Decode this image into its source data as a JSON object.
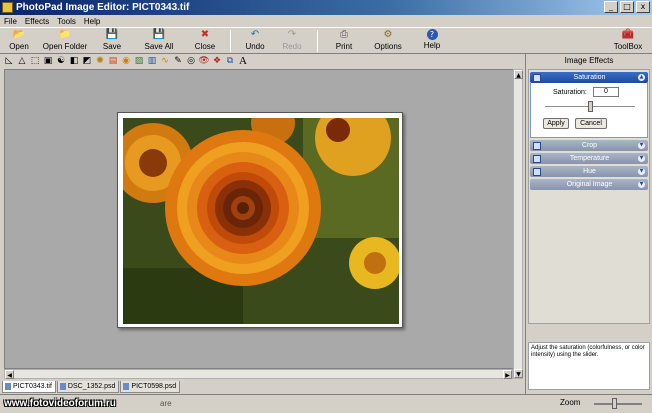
{
  "window": {
    "title": "PhotoPad Image Editor: PICT0343.tif",
    "controls": [
      "_",
      "□",
      "x"
    ]
  },
  "menu": [
    "File",
    "Effects",
    "Tools",
    "Help"
  ],
  "toolbar": [
    {
      "id": "open",
      "label": "Open",
      "icon": "open-icon",
      "glyph": "📂",
      "enabled": true
    },
    {
      "id": "open-folder",
      "label": "Open Folder",
      "icon": "open-folder-icon",
      "glyph": "📁",
      "enabled": true
    },
    {
      "id": "save",
      "label": "Save",
      "icon": "save-icon",
      "glyph": "💾",
      "enabled": true
    },
    {
      "id": "save-all",
      "label": "Save All",
      "icon": "save-all-icon",
      "glyph": "💾",
      "enabled": true
    },
    {
      "id": "close",
      "label": "Close",
      "icon": "close-icon",
      "glyph": "✖",
      "enabled": true
    },
    {
      "id": "undo",
      "label": "Undo",
      "icon": "undo-icon",
      "glyph": "↶",
      "enabled": true
    },
    {
      "id": "redo",
      "label": "Redo",
      "icon": "redo-icon",
      "glyph": "↷",
      "enabled": false
    },
    {
      "id": "print",
      "label": "Print",
      "icon": "print-icon",
      "glyph": "⎙",
      "enabled": true
    },
    {
      "id": "options",
      "label": "Options",
      "icon": "options-icon",
      "glyph": "⚙",
      "enabled": true
    },
    {
      "id": "help",
      "label": "Help",
      "icon": "help-icon",
      "glyph": "?",
      "enabled": true
    },
    {
      "id": "toolbox",
      "label": "ToolBox",
      "icon": "toolbox-icon",
      "glyph": "🧰",
      "enabled": true
    }
  ],
  "tools": [
    {
      "name": "crop-tool-icon",
      "glyph": "◺"
    },
    {
      "name": "triangle-tool-icon",
      "glyph": "△"
    },
    {
      "name": "select-tool-icon",
      "glyph": "⬚"
    },
    {
      "name": "rect-select-tool-icon",
      "glyph": "▣"
    },
    {
      "name": "yin-yang-tool-icon",
      "glyph": "☯"
    },
    {
      "name": "contrast-tool-icon",
      "glyph": "◧"
    },
    {
      "name": "levels-tool-icon",
      "glyph": "◩"
    },
    {
      "name": "brightness-tool-icon",
      "glyph": "✺"
    },
    {
      "name": "gradient-tool-icon",
      "glyph": "▤"
    },
    {
      "name": "color-tool-icon",
      "glyph": "◉"
    },
    {
      "name": "landscape-tool-icon",
      "glyph": "▨"
    },
    {
      "name": "histogram-tool-icon",
      "glyph": "▥"
    },
    {
      "name": "wave-tool-icon",
      "glyph": "∿"
    },
    {
      "name": "brush-tool-icon",
      "glyph": "✎"
    },
    {
      "name": "vignette-tool-icon",
      "glyph": "◎"
    },
    {
      "name": "red-eye-tool-icon",
      "glyph": "👁"
    },
    {
      "name": "spots-tool-icon",
      "glyph": "❖"
    },
    {
      "name": "layers-tool-icon",
      "glyph": "⧉"
    },
    {
      "name": "text-tool-icon",
      "glyph": "A"
    }
  ],
  "panel": {
    "title": "Image Effects",
    "effects": [
      {
        "label": "Saturation",
        "expanded": true
      },
      {
        "label": "Crop",
        "expanded": false
      },
      {
        "label": "Temperature",
        "expanded": false
      },
      {
        "label": "Hue",
        "expanded": false
      },
      {
        "label": "Original Image",
        "expanded": false
      }
    ],
    "saturation": {
      "label": "Saturation:",
      "value": "0",
      "slider_level": 0.5
    },
    "buttons": {
      "apply": "Apply",
      "cancel": "Cancel"
    },
    "help_text": "Adjust the saturation (colorfulness, or color intensity) using the slider."
  },
  "file_tabs": [
    {
      "label": "PICT0343.tif",
      "active": true
    },
    {
      "label": "DSC_1352.psd",
      "active": false
    },
    {
      "label": "PICT0598.psd",
      "active": false
    }
  ],
  "status": {
    "watermark": "www.fotovideoforum.ru",
    "suffix": "are",
    "zoom_label": "Zoom"
  },
  "colors": {
    "title_bar": "#0a246a",
    "active_effect": "#1c4aa0",
    "canvas_bg": "#a9a9a9"
  }
}
